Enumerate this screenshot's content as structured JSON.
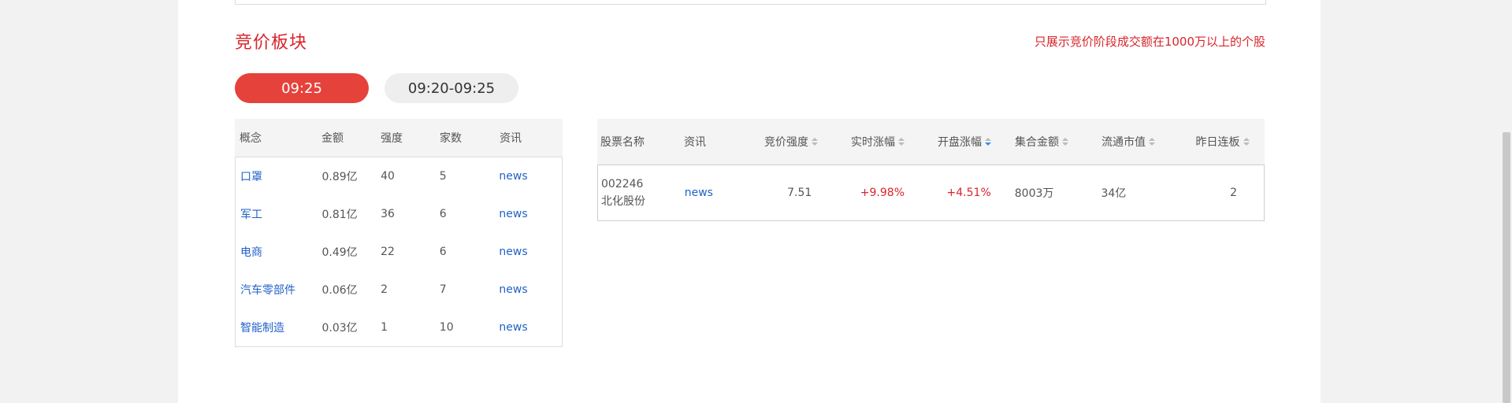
{
  "section": {
    "title": "竞价板块",
    "notice": "只展示竞价阶段成交额在1000万以上的个股"
  },
  "tabs": [
    {
      "label": "09:25",
      "active": true
    },
    {
      "label": "09:20-09:25",
      "active": false
    }
  ],
  "concepts": {
    "headers": [
      "概念",
      "金额",
      "强度",
      "家数",
      "资讯"
    ],
    "rows": [
      {
        "name": "口罩",
        "amount": "0.89亿",
        "strength": "40",
        "count": "5",
        "news": "news"
      },
      {
        "name": "军工",
        "amount": "0.81亿",
        "strength": "36",
        "count": "6",
        "news": "news"
      },
      {
        "name": "电商",
        "amount": "0.49亿",
        "strength": "22",
        "count": "6",
        "news": "news"
      },
      {
        "name": "汽车零部件",
        "amount": "0.06亿",
        "strength": "2",
        "count": "7",
        "news": "news"
      },
      {
        "name": "智能制造",
        "amount": "0.03亿",
        "strength": "1",
        "count": "10",
        "news": "news"
      }
    ]
  },
  "stocks": {
    "headers": [
      "股票名称",
      "资讯",
      "竞价强度",
      "实时涨幅",
      "开盘涨幅",
      "集合金额",
      "流通市值",
      "昨日连板"
    ],
    "rows": [
      {
        "code": "002246",
        "name": "北化股份",
        "news": "news",
        "strength": "7.51",
        "realtime_change": "+9.98%",
        "open_change": "+4.51%",
        "auction_amount": "8003万",
        "float_cap": "34亿",
        "prev_limit_days": "2"
      }
    ]
  },
  "colors": {
    "accent": "#e5423b",
    "red_text": "#d9242b",
    "link": "#2262c9",
    "sort_active": "#3a8ee6"
  }
}
